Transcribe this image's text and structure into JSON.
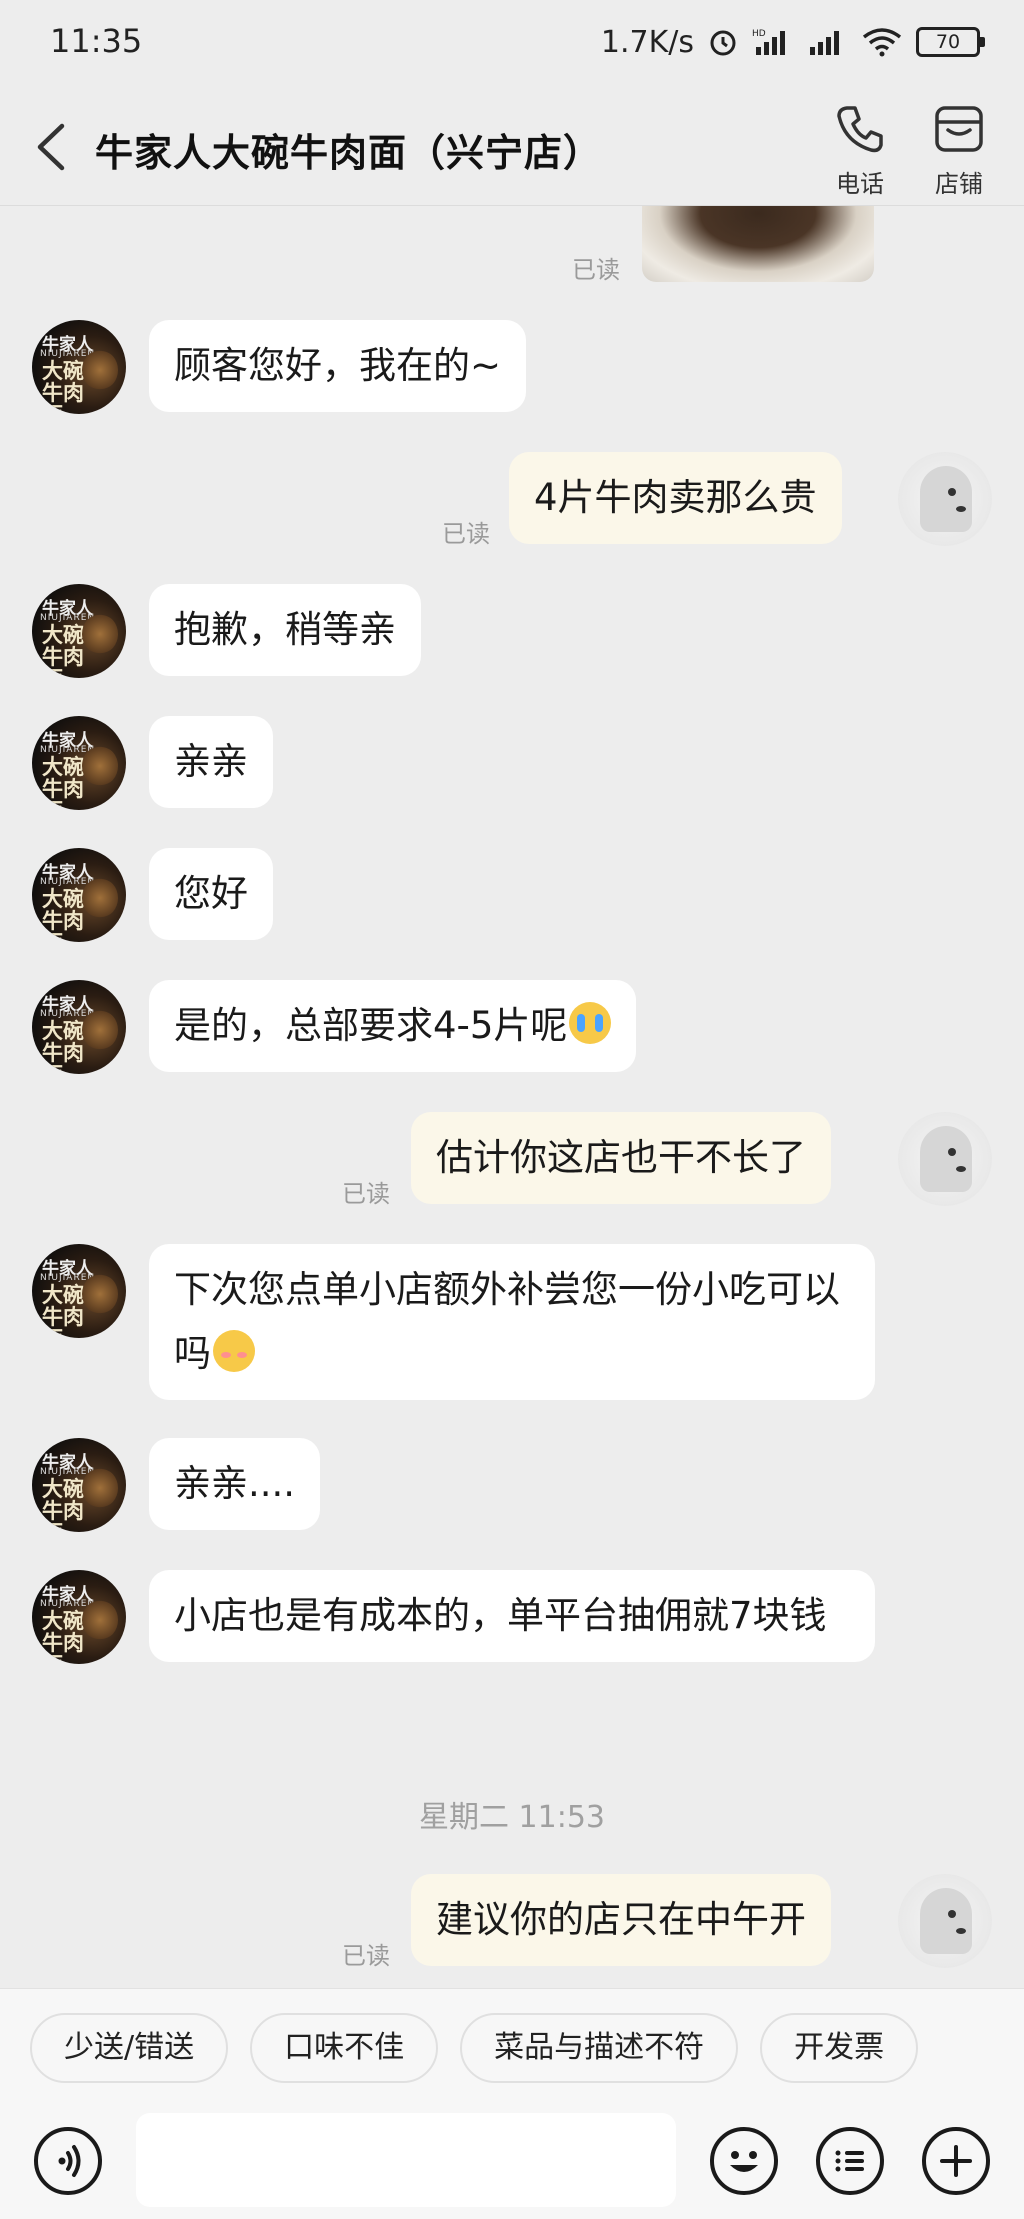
{
  "status_bar": {
    "time": "11:35",
    "net_speed": "1.7K/s",
    "battery": "70"
  },
  "header": {
    "title": "牛家人大碗牛肉面（兴宁店）",
    "phone_label": "电话",
    "shop_label": "店铺"
  },
  "shop_avatar": {
    "top_text": "牛家人",
    "en_text": "NIUJIAREN",
    "big_text": "大碗牛肉面"
  },
  "messages": [
    {
      "side": "out",
      "type": "image",
      "read": "已读"
    },
    {
      "side": "in",
      "text": "顾客您好，我在的~"
    },
    {
      "side": "out",
      "text": "4片牛肉卖那么贵",
      "read": "已读"
    },
    {
      "side": "in",
      "text": "抱歉，稍等亲"
    },
    {
      "side": "in",
      "text": "亲亲"
    },
    {
      "side": "in",
      "text": "您好"
    },
    {
      "side": "in",
      "text": "是的，总部要求4-5片呢",
      "emoji": "crying-face-emoji"
    },
    {
      "side": "out",
      "text": "估计你这店也干不长了",
      "read": "已读"
    },
    {
      "side": "in",
      "text": "下次您点单小店额外补尝您一份小吃可以吗",
      "emoji": "blushing-face-emoji"
    },
    {
      "side": "in",
      "text": "亲亲...."
    },
    {
      "side": "in",
      "text": "小店也是有成本的，单平台抽佣就7块钱"
    },
    {
      "type": "timestamp",
      "text": "星期二 11:53"
    },
    {
      "side": "out",
      "text": "建议你的店只在中午开",
      "read": "已读"
    }
  ],
  "quick_replies": [
    "少送/错送",
    "口味不佳",
    "菜品与描述不符",
    "开发票"
  ],
  "input": {
    "placeholder": "",
    "value": ""
  },
  "icons": {
    "back": "chevron-left-icon",
    "phone": "phone-icon",
    "shop": "shop-icon",
    "voice": "voice-icon",
    "emoji": "emoji-icon",
    "more": "menu-icon",
    "plus": "plus-icon"
  },
  "colors": {
    "background": "#ededed",
    "incoming_bubble": "#ffffff",
    "outgoing_bubble": "#fbf7e9",
    "read_text": "#9a9a9a"
  }
}
